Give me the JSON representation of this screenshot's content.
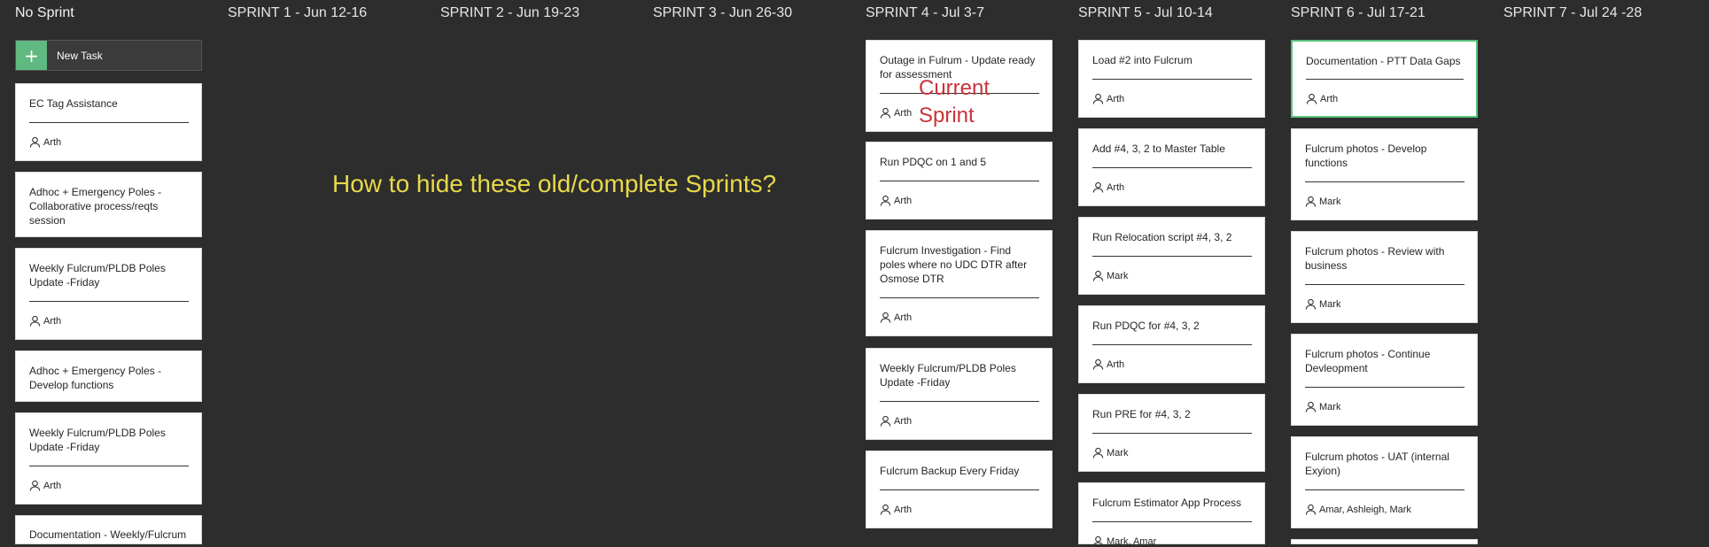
{
  "columns": [
    {
      "title": "No Sprint"
    },
    {
      "title": "SPRINT 1 - Jun 12-16"
    },
    {
      "title": "SPRINT 2 - Jun 19-23"
    },
    {
      "title": "SPRINT 3 - Jun 26-30"
    },
    {
      "title": "SPRINT 4 - Jul 3-7"
    },
    {
      "title": "SPRINT 5 - Jul 10-14"
    },
    {
      "title": "SPRINT 6 - Jul 17-21"
    },
    {
      "title": "SPRINT 7 - Jul 24 -28"
    }
  ],
  "new_task": {
    "icon": "plus-icon",
    "label": "New Task"
  },
  "annotations": {
    "question": "How to hide these old/complete Sprints?",
    "current_sprint_line1": "Current",
    "current_sprint_line2": "Sprint"
  },
  "cards": {
    "no_sprint": [
      {
        "title": "EC Tag Assistance",
        "assignee": "Arth"
      },
      {
        "title": "Adhoc + Emergency Poles - Collaborative process/reqts session",
        "assignee": ""
      },
      {
        "title": "Weekly Fulcrum/PLDB Poles Update -Friday",
        "assignee": "Arth"
      },
      {
        "title": "Adhoc + Emergency Poles - Develop functions",
        "assignee": ""
      },
      {
        "title": "Weekly Fulcrum/PLDB Poles Update -Friday",
        "assignee": "Arth"
      },
      {
        "title": "Documentation - Weekly/Fulcrum",
        "assignee": ""
      }
    ],
    "sprint4": [
      {
        "title": "Outage in Fulrum - Update ready for assessment",
        "assignee": "Arth"
      },
      {
        "title": "Run PDQC on 1 and 5",
        "assignee": "Arth"
      },
      {
        "title": "Fulcrum Investigation - Find poles where no UDC DTR after Osmose DTR",
        "assignee": "Arth"
      },
      {
        "title": "Weekly Fulcrum/PLDB Poles Update -Friday",
        "assignee": "Arth"
      },
      {
        "title": "Fulcrum Backup Every Friday",
        "assignee": "Arth"
      }
    ],
    "sprint5": [
      {
        "title": "Load #2 into Fulcrum",
        "assignee": "Arth"
      },
      {
        "title": "Add #4, 3, 2 to Master Table",
        "assignee": "Arth"
      },
      {
        "title": "Run Relocation script #4, 3, 2",
        "assignee": "Mark"
      },
      {
        "title": "Run PDQC for #4, 3, 2",
        "assignee": "Arth"
      },
      {
        "title": "Run PRE for #4, 3, 2",
        "assignee": "Mark"
      },
      {
        "title": "Fulcrum Estimator App Process",
        "assignee": "Mark, Amar"
      }
    ],
    "sprint6": [
      {
        "title": "Documentation - PTT Data Gaps",
        "assignee": "Arth"
      },
      {
        "title": "Fulcrum photos - Develop functions",
        "assignee": "Mark"
      },
      {
        "title": "Fulcrum photos - Review with business",
        "assignee": "Mark"
      },
      {
        "title": "Fulcrum photos - Continue Devleopment",
        "assignee": "Mark"
      },
      {
        "title": "Fulcrum photos - UAT (internal Exyion)",
        "assignee": "Amar, Ashleigh, Mark"
      }
    ]
  },
  "colors": {
    "background": "#2d2d2d",
    "new_task_accent": "#5fb980",
    "selected_border": "#57c17b",
    "question_text": "#e8d94a",
    "current_sprint_text": "#c8343a"
  }
}
